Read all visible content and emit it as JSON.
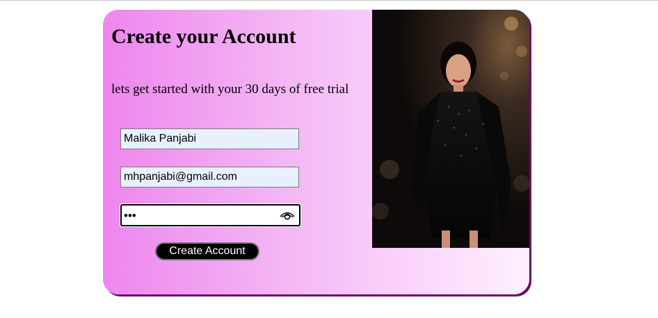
{
  "form": {
    "title": "Create your Account",
    "subtitle": "lets get started with your 30 days of free trial",
    "name_value": "Malika Panjabi",
    "email_value": "mhpanjabi@gmail.com",
    "password_display": "•••",
    "submit_label": "Create Account"
  },
  "icons": {
    "password_toggle": "eye-icon"
  },
  "colors": {
    "gradient_start": "#ee86ee",
    "gradient_end": "#fdf1fd",
    "card_shadow": "#6d0a6a",
    "autofill_bg": "#e8f0fe",
    "button_bg": "#000000"
  }
}
